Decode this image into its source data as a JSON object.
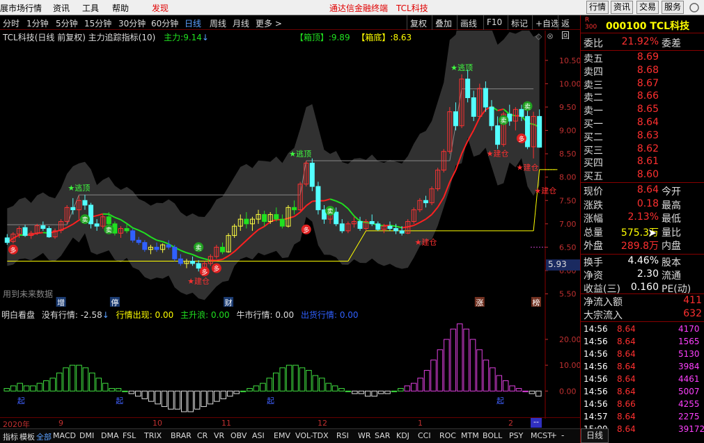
{
  "menubar": {
    "items": [
      "展市场行情",
      "资讯",
      "工具",
      "帮助"
    ],
    "discover": "发现",
    "center_title": "通达信金融终端",
    "center_stock": "TCL科技",
    "buttons": [
      "行情",
      "资讯",
      "交易",
      "服务"
    ]
  },
  "toolbar": {
    "periods": [
      "分时",
      "1分钟",
      "5分钟",
      "15分钟",
      "30分钟",
      "60分钟",
      "日线",
      "周线",
      "月线",
      "更多 >"
    ],
    "active_period": "日线",
    "right_buttons": [
      "复权",
      "叠加",
      "画线",
      "F10",
      "标记",
      "+自选",
      "返回"
    ]
  },
  "chart_info": {
    "title": "TCL科技(日线 前复权) 主力追踪指标(10)",
    "zhuli_label": "主力:",
    "zhuli_value": "9.14",
    "box_top_label": "【箱顶】:",
    "box_top_value": "9.89",
    "box_bottom_label": "【箱底】:",
    "box_bottom_value": "8.63",
    "future_label": "用到未来数据",
    "current_price_tag": "5.93"
  },
  "chart_data": [
    {
      "type": "candlestick",
      "title": "TCL科技(日线 前复权) 主力追踪指标(10)",
      "yticks": [
        "10.50",
        "10.00",
        "9.50",
        "9.00",
        "8.50",
        "8.00",
        "7.50",
        "7.00",
        "6.50",
        "6.00",
        "5.50"
      ],
      "ylim": [
        5.3,
        10.75
      ],
      "candles": [
        [
          6.7,
          6.78,
          6.55,
          6.6
        ],
        [
          6.62,
          6.82,
          6.58,
          6.78
        ],
        [
          6.78,
          6.95,
          6.7,
          6.9
        ],
        [
          6.92,
          6.98,
          6.72,
          6.75
        ],
        [
          6.75,
          6.85,
          6.68,
          6.8
        ],
        [
          6.8,
          7.0,
          6.76,
          6.96
        ],
        [
          6.96,
          7.05,
          6.85,
          6.9
        ],
        [
          6.9,
          6.95,
          6.7,
          6.72
        ],
        [
          6.72,
          6.9,
          6.68,
          6.85
        ],
        [
          6.86,
          7.1,
          6.8,
          7.05
        ],
        [
          7.05,
          7.4,
          7.0,
          7.35
        ],
        [
          7.35,
          7.55,
          7.2,
          7.3
        ],
        [
          7.3,
          7.6,
          7.1,
          7.5
        ],
        [
          7.5,
          7.62,
          7.3,
          7.4
        ],
        [
          7.4,
          7.45,
          6.9,
          7.0
        ],
        [
          7.0,
          7.1,
          6.85,
          6.95
        ],
        [
          6.95,
          7.2,
          6.9,
          7.15
        ],
        [
          7.15,
          7.25,
          6.95,
          7.0
        ],
        [
          7.0,
          7.05,
          6.75,
          6.8
        ],
        [
          6.8,
          6.95,
          6.7,
          6.9
        ],
        [
          6.9,
          7.0,
          6.8,
          6.85
        ],
        [
          6.85,
          6.9,
          6.6,
          6.65
        ],
        [
          6.65,
          6.72,
          6.55,
          6.6
        ],
        [
          6.6,
          6.65,
          6.4,
          6.45
        ],
        [
          6.45,
          6.55,
          6.35,
          6.5
        ],
        [
          6.5,
          6.6,
          6.4,
          6.45
        ],
        [
          6.45,
          6.58,
          6.38,
          6.55
        ],
        [
          6.55,
          6.65,
          6.45,
          6.5
        ],
        [
          6.5,
          6.55,
          6.2,
          6.25
        ],
        [
          6.25,
          6.35,
          6.1,
          6.15
        ],
        [
          6.15,
          6.25,
          6.05,
          6.2
        ],
        [
          6.2,
          6.3,
          6.1,
          6.15
        ],
        [
          6.15,
          6.22,
          5.98,
          6.05
        ],
        [
          6.05,
          6.2,
          5.95,
          6.15
        ],
        [
          6.15,
          6.35,
          6.1,
          6.3
        ],
        [
          6.3,
          6.55,
          6.25,
          6.5
        ],
        [
          6.5,
          6.6,
          6.35,
          6.4
        ],
        [
          6.4,
          6.8,
          6.38,
          6.75
        ],
        [
          6.75,
          7.0,
          6.7,
          6.95
        ],
        [
          6.95,
          7.2,
          6.85,
          7.1
        ],
        [
          7.1,
          7.25,
          6.9,
          7.0
        ],
        [
          7.0,
          7.15,
          6.85,
          7.1
        ],
        [
          7.1,
          7.3,
          7.0,
          7.2
        ],
        [
          7.2,
          7.28,
          6.95,
          7.05
        ],
        [
          7.05,
          7.25,
          7.0,
          7.2
        ],
        [
          7.2,
          7.35,
          7.05,
          7.1
        ],
        [
          7.1,
          7.2,
          6.9,
          6.95
        ],
        [
          6.95,
          7.4,
          6.92,
          7.35
        ],
        [
          7.35,
          7.5,
          7.2,
          7.3
        ],
        [
          7.3,
          7.9,
          7.28,
          7.85
        ],
        [
          7.85,
          8.35,
          7.8,
          8.3
        ],
        [
          8.3,
          8.4,
          7.7,
          7.8
        ],
        [
          7.8,
          7.9,
          7.2,
          7.3
        ],
        [
          7.3,
          7.4,
          7.0,
          7.1
        ],
        [
          7.1,
          7.3,
          7.0,
          7.25
        ],
        [
          7.25,
          7.35,
          6.95,
          7.0
        ],
        [
          7.0,
          7.1,
          6.8,
          6.85
        ],
        [
          6.85,
          7.05,
          6.8,
          7.0
        ],
        [
          7.0,
          7.15,
          6.92,
          7.05
        ],
        [
          7.05,
          7.15,
          6.85,
          6.9
        ],
        [
          6.9,
          7.1,
          6.85,
          7.05
        ],
        [
          7.05,
          7.2,
          6.95,
          7.0
        ],
        [
          7.0,
          7.05,
          6.85,
          6.88
        ],
        [
          6.88,
          7.0,
          6.8,
          6.95
        ],
        [
          6.95,
          7.05,
          6.85,
          6.9
        ],
        [
          6.9,
          7.0,
          6.78,
          6.85
        ],
        [
          6.85,
          6.95,
          6.75,
          6.8
        ],
        [
          6.8,
          7.1,
          6.78,
          7.05
        ],
        [
          7.05,
          7.35,
          7.0,
          7.3
        ],
        [
          7.3,
          7.55,
          7.25,
          7.5
        ],
        [
          7.5,
          7.6,
          7.35,
          7.45
        ],
        [
          7.45,
          7.8,
          7.4,
          7.75
        ],
        [
          7.75,
          8.2,
          7.7,
          8.15
        ],
        [
          8.15,
          8.6,
          8.1,
          8.55
        ],
        [
          8.55,
          9.5,
          8.5,
          9.4
        ],
        [
          9.4,
          9.6,
          9.0,
          9.1
        ],
        [
          9.1,
          10.2,
          9.05,
          10.1
        ],
        [
          10.1,
          10.3,
          9.6,
          9.7
        ],
        [
          9.7,
          9.85,
          9.2,
          9.3
        ],
        [
          9.3,
          10.0,
          9.25,
          9.9
        ],
        [
          9.9,
          10.05,
          9.4,
          9.5
        ],
        [
          9.5,
          9.65,
          9.0,
          9.1
        ],
        [
          9.1,
          9.3,
          8.6,
          8.7
        ],
        [
          8.7,
          9.4,
          8.65,
          9.35
        ],
        [
          9.35,
          9.55,
          9.1,
          9.2
        ],
        [
          9.2,
          9.5,
          9.0,
          9.45
        ],
        [
          9.45,
          9.55,
          9.2,
          9.3
        ],
        [
          9.3,
          9.6,
          8.6,
          8.65
        ],
        [
          8.65,
          9.4,
          8.4,
          9.3
        ],
        [
          9.3,
          9.45,
          8.63,
          8.64
        ]
      ],
      "signals": {
        "top": "★逃顶",
        "build": "★建仓",
        "sell": "卖",
        "buy": "多"
      },
      "bottom_markers": [
        "增",
        "停",
        "财",
        "涨",
        "榜"
      ]
    },
    {
      "type": "bar",
      "title": "明白看盘",
      "series": [
        {
          "name": "没有行情",
          "value": "-2.58"
        },
        {
          "name": "行情出现",
          "value": "0.00"
        },
        {
          "name": "主升浪",
          "value": "0.00"
        },
        {
          "name": "牛市行情",
          "value": "0.00"
        },
        {
          "name": "出货行情",
          "value": "0.00"
        }
      ],
      "yticks": [
        "20.00",
        "10.00",
        "0.00"
      ],
      "ylim": [
        -8,
        27
      ],
      "values": [
        1,
        2,
        3,
        2,
        2,
        3,
        4,
        5,
        7,
        9,
        10,
        10,
        9,
        7,
        5,
        3,
        1,
        1,
        0,
        -1,
        -2,
        -3,
        -4,
        -5,
        -6,
        -7,
        -7,
        -8,
        -8,
        -7,
        -6,
        -5,
        -4,
        -3,
        -2,
        -1,
        0,
        1,
        2,
        3,
        5,
        7,
        9,
        10,
        10,
        9,
        8,
        6,
        5,
        3,
        2,
        1,
        0,
        -1,
        -1,
        -2,
        -2,
        -1,
        -1,
        0,
        1,
        2,
        3,
        5,
        8,
        12,
        16,
        20,
        24,
        26,
        24,
        20,
        16,
        12,
        9,
        6,
        4,
        2,
        1,
        0,
        -1,
        -2
      ],
      "markers": [
        "起",
        "起",
        "起",
        "起"
      ]
    }
  ],
  "dateaxis": {
    "year": "2020年",
    "labels": [
      "9",
      "10",
      "11",
      "12",
      "1",
      "2"
    ]
  },
  "bottombar": {
    "tabs": [
      "指标",
      "模板",
      "全部",
      "MACD",
      "DMI",
      "DMA",
      "FSL",
      "TRIX",
      "BRAR",
      "CR",
      "VR",
      "OBV",
      "ASI",
      "EMV",
      "VOL-TDX",
      "RSI",
      "WR",
      "SAR",
      "KDJ",
      "CCI",
      "ROC",
      "MTM",
      "BOLL",
      "PSY",
      "MCST"
    ],
    "active": "全部",
    "period_label": "日线",
    "plus": "+",
    "minus": "-"
  },
  "sidepanel": {
    "rtag": "R\n300",
    "code": "000100 TCL科技",
    "weibi_label": "委比",
    "weibi_value": "21.92%",
    "weicha_label": "委差",
    "weicha_value": "",
    "asks": [
      {
        "label": "卖五",
        "price": "8.69"
      },
      {
        "label": "卖四",
        "price": "8.68"
      },
      {
        "label": "卖三",
        "price": "8.67"
      },
      {
        "label": "卖二",
        "price": "8.66"
      },
      {
        "label": "卖一",
        "price": "8.65"
      }
    ],
    "bids": [
      {
        "label": "买一",
        "price": "8.64"
      },
      {
        "label": "买二",
        "price": "8.63"
      },
      {
        "label": "买三",
        "price": "8.62"
      },
      {
        "label": "买四",
        "price": "8.61"
      },
      {
        "label": "买五",
        "price": "8.60"
      }
    ],
    "stats": [
      {
        "label": "现价",
        "value": "8.64",
        "label2": "今开"
      },
      {
        "label": "涨跌",
        "value": "0.18",
        "label2": "最高"
      },
      {
        "label": "涨幅",
        "value": "2.13%",
        "label2": "最低"
      },
      {
        "label": "总量",
        "value": "575.3万",
        "label2": "量比"
      },
      {
        "label": "外盘",
        "value": "289.8万",
        "label2": "内盘"
      }
    ],
    "stats2": [
      {
        "label": "换手",
        "value": "4.46%",
        "label2": "股本"
      },
      {
        "label": "净资",
        "value": "2.30",
        "label2": "流通"
      },
      {
        "label": "收益(三)",
        "value": "0.160",
        "label2": "PE(动)"
      }
    ],
    "flows": [
      {
        "label": "净流入额",
        "value": "411"
      },
      {
        "label": "大宗流入",
        "value": "632"
      }
    ],
    "ticks": [
      {
        "time": "14:56",
        "price": "8.64",
        "vol": "4170"
      },
      {
        "time": "14:56",
        "price": "8.64",
        "vol": "1565"
      },
      {
        "time": "14:56",
        "price": "8.64",
        "vol": "5130"
      },
      {
        "time": "14:56",
        "price": "8.64",
        "vol": "3984"
      },
      {
        "time": "14:56",
        "price": "8.64",
        "vol": "4461"
      },
      {
        "time": "14:56",
        "price": "8.64",
        "vol": "5007"
      },
      {
        "time": "14:56",
        "price": "8.66",
        "vol": "4255"
      },
      {
        "time": "14:57",
        "price": "8.64",
        "vol": "2275"
      },
      {
        "time": "15:00",
        "price": "8.64",
        "vol": "39172"
      }
    ]
  },
  "colors": {
    "up": "#ff3232",
    "down": "#54ffff",
    "ma_red": "#ff2020",
    "ma_green": "#20e020",
    "yellow": "#ffff00",
    "band": "#3a3a3a"
  }
}
